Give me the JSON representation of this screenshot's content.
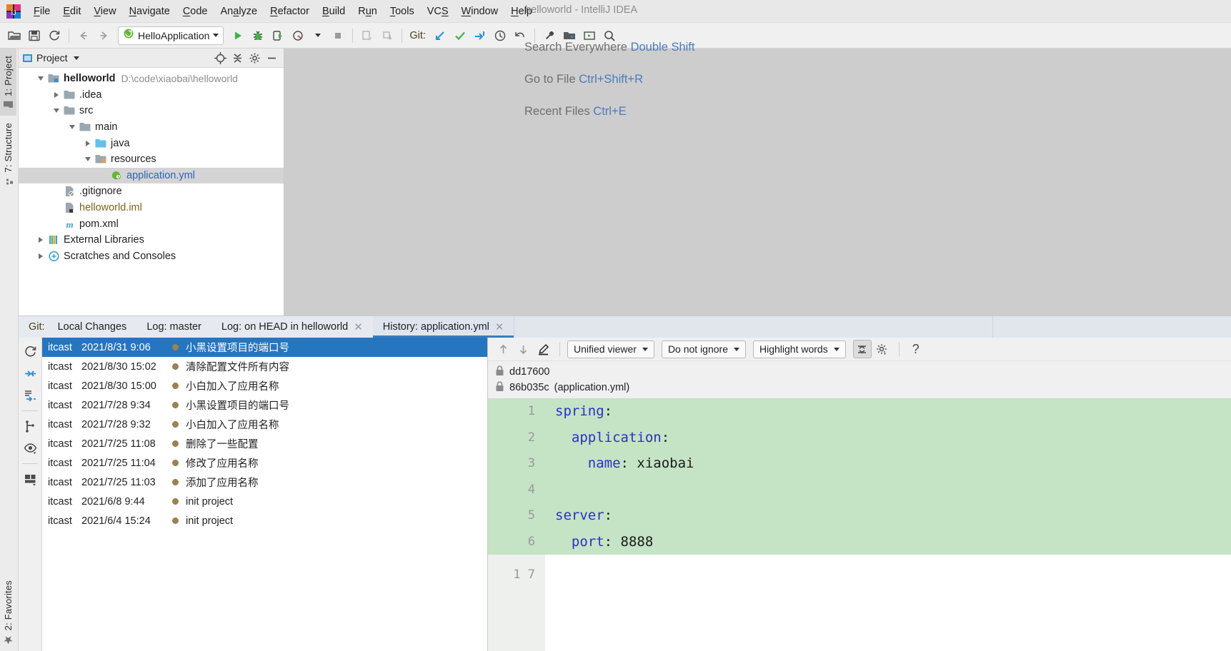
{
  "titlebar": {
    "window_title": "helloworld - IntelliJ IDEA",
    "menus": [
      {
        "label": "File",
        "mn": "F"
      },
      {
        "label": "Edit",
        "mn": "E"
      },
      {
        "label": "View",
        "mn": "V"
      },
      {
        "label": "Navigate",
        "mn": "N"
      },
      {
        "label": "Code",
        "mn": "C"
      },
      {
        "label": "Analyze",
        "mn": "A"
      },
      {
        "label": "Refactor",
        "mn": "R"
      },
      {
        "label": "Build",
        "mn": "B"
      },
      {
        "label": "Run",
        "mn": "u"
      },
      {
        "label": "Tools",
        "mn": "T"
      },
      {
        "label": "VCS",
        "mn": "S"
      },
      {
        "label": "Window",
        "mn": "W"
      },
      {
        "label": "Help",
        "mn": "H"
      }
    ]
  },
  "toolbar": {
    "run_configuration": "HelloApplication",
    "git_label": "Git:",
    "icons": [
      "open-project-icon",
      "save-all-icon",
      "sync-icon",
      "back-icon",
      "forward-icon",
      "run-icon",
      "debug-icon",
      "run-with-coverage-icon",
      "profile-icon",
      "stop-icon",
      "update-project-icon",
      "commit-icon",
      "git-pull-icon",
      "git-commit-check-icon",
      "git-push-icon",
      "git-history-icon",
      "git-revert-icon",
      "settings-wrench-icon",
      "project-structure-icon",
      "presentation-icon",
      "search-icon"
    ]
  },
  "left_tool_tabs": [
    {
      "label": "1: Project",
      "icon": "project-folder-icon",
      "active": true
    },
    {
      "label": "7: Structure",
      "icon": "structure-icon",
      "active": false
    }
  ],
  "left_bottom_tabs": [
    {
      "label": "2: Favorites",
      "icon": "star-icon"
    }
  ],
  "project": {
    "header_title": "Project",
    "header_icons": [
      "locate-icon",
      "collapse-all-icon",
      "gear-icon",
      "hide-icon"
    ],
    "tree": [
      {
        "depth": 0,
        "twisty": "down",
        "icon": "module-folder-icon",
        "name": "helloworld",
        "bold": true,
        "path": "D:\\code\\xiaobai\\helloworld"
      },
      {
        "depth": 1,
        "twisty": "right",
        "icon": "folder-icon",
        "name": ".idea"
      },
      {
        "depth": 1,
        "twisty": "down",
        "icon": "folder-icon",
        "name": "src"
      },
      {
        "depth": 2,
        "twisty": "down",
        "icon": "folder-icon",
        "name": "main"
      },
      {
        "depth": 3,
        "twisty": "right",
        "icon": "source-folder-icon",
        "name": "java"
      },
      {
        "depth": 3,
        "twisty": "down",
        "icon": "resources-folder-icon",
        "name": "resources"
      },
      {
        "depth": 4,
        "twisty": "none",
        "icon": "spring-yaml-icon",
        "name": "application.yml",
        "selected": true,
        "style": "yml"
      },
      {
        "depth": 1,
        "twisty": "none",
        "icon": "gitignore-file-icon",
        "name": ".gitignore"
      },
      {
        "depth": 1,
        "twisty": "none",
        "icon": "iml-file-icon",
        "name": "helloworld.iml",
        "style": "iml"
      },
      {
        "depth": 1,
        "twisty": "none",
        "icon": "maven-pom-icon",
        "name": "pom.xml"
      },
      {
        "depth": 0,
        "twisty": "right",
        "icon": "libraries-icon",
        "name": "External Libraries"
      },
      {
        "depth": 0,
        "twisty": "right",
        "icon": "scratches-icon",
        "name": "Scratches and Consoles"
      }
    ]
  },
  "editor_hints": [
    {
      "action": "Search Everywhere",
      "shortcut": "Double Shift"
    },
    {
      "action": "Go to File",
      "shortcut": "Ctrl+Shift+R"
    },
    {
      "action": "Recent Files",
      "shortcut": "Ctrl+E"
    }
  ],
  "git_panel": {
    "label": "Git:",
    "tabs": [
      {
        "label": "Local Changes",
        "closable": false,
        "active": false
      },
      {
        "label": "Log: master",
        "closable": false,
        "active": false
      },
      {
        "label": "Log: on HEAD in helloworld",
        "closable": true,
        "active": false
      },
      {
        "label": "History: application.yml",
        "closable": true,
        "active": true
      }
    ],
    "side_tools": [
      "refresh-icon",
      "collapse-icon",
      "expand-all-icon",
      "branch-icon",
      "eye-icon",
      "layout-icon"
    ],
    "commits": [
      {
        "author": "itcast",
        "date": "2021/8/31 9:06",
        "message": "小黑设置项目的端口号",
        "selected": true
      },
      {
        "author": "itcast",
        "date": "2021/8/30 15:02",
        "message": "清除配置文件所有内容"
      },
      {
        "author": "itcast",
        "date": "2021/8/30 15:00",
        "message": "小白加入了应用名称"
      },
      {
        "author": "itcast",
        "date": "2021/7/28 9:34",
        "message": "小黑设置项目的端口号"
      },
      {
        "author": "itcast",
        "date": "2021/7/28 9:32",
        "message": "小白加入了应用名称"
      },
      {
        "author": "itcast",
        "date": "2021/7/25 11:08",
        "message": "删除了一些配置"
      },
      {
        "author": "itcast",
        "date": "2021/7/25 11:04",
        "message": "修改了应用名称"
      },
      {
        "author": "itcast",
        "date": "2021/7/25 11:03",
        "message": "添加了应用名称"
      },
      {
        "author": "itcast",
        "date": "2021/6/8 9:44",
        "message": "init project"
      },
      {
        "author": "itcast",
        "date": "2021/6/4 15:24",
        "message": "init project"
      }
    ]
  },
  "diff": {
    "toolbar": {
      "prev_label": "previous-difference-icon",
      "next_label": "next-difference-icon",
      "edit_label": "edit-source-icon",
      "viewer_mode": "Unified viewer",
      "ignore_mode": "Do not ignore",
      "highlight_mode": "Highlight words",
      "help_label": "?"
    },
    "revisions": [
      {
        "hash": "dd17600",
        "file": ""
      },
      {
        "hash": "86b035c",
        "file": "(application.yml)"
      }
    ],
    "lines": [
      {
        "no": "1",
        "text": "spring:",
        "highlight": true,
        "tokens": [
          {
            "t": "spring",
            "c": "key"
          },
          {
            "t": ":",
            "c": "plain"
          }
        ]
      },
      {
        "no": "2",
        "text": "  application:",
        "highlight": true,
        "tokens": [
          {
            "t": "  application",
            "c": "key"
          },
          {
            "t": ":",
            "c": "plain"
          }
        ]
      },
      {
        "no": "3",
        "text": "    name: xiaobai",
        "highlight": true,
        "tokens": [
          {
            "t": "    name",
            "c": "key"
          },
          {
            "t": ": xiaobai",
            "c": "plain"
          }
        ]
      },
      {
        "no": "4",
        "text": "",
        "highlight": true,
        "tokens": []
      },
      {
        "no": "5",
        "text": "server:",
        "highlight": true,
        "tokens": [
          {
            "t": "server",
            "c": "key"
          },
          {
            "t": ":",
            "c": "plain"
          }
        ]
      },
      {
        "no": "6",
        "text": "  port: 8888",
        "highlight": true,
        "tokens": [
          {
            "t": "  port",
            "c": "key"
          },
          {
            "t": ": 8888",
            "c": "plain"
          }
        ]
      }
    ],
    "footer_gutter": "1 7"
  },
  "colors": {
    "selection_blue": "#2675bf",
    "diff_green": "#c5e3c5",
    "accent_link": "#4a7bbf",
    "graph_brown": "#9b8252"
  }
}
